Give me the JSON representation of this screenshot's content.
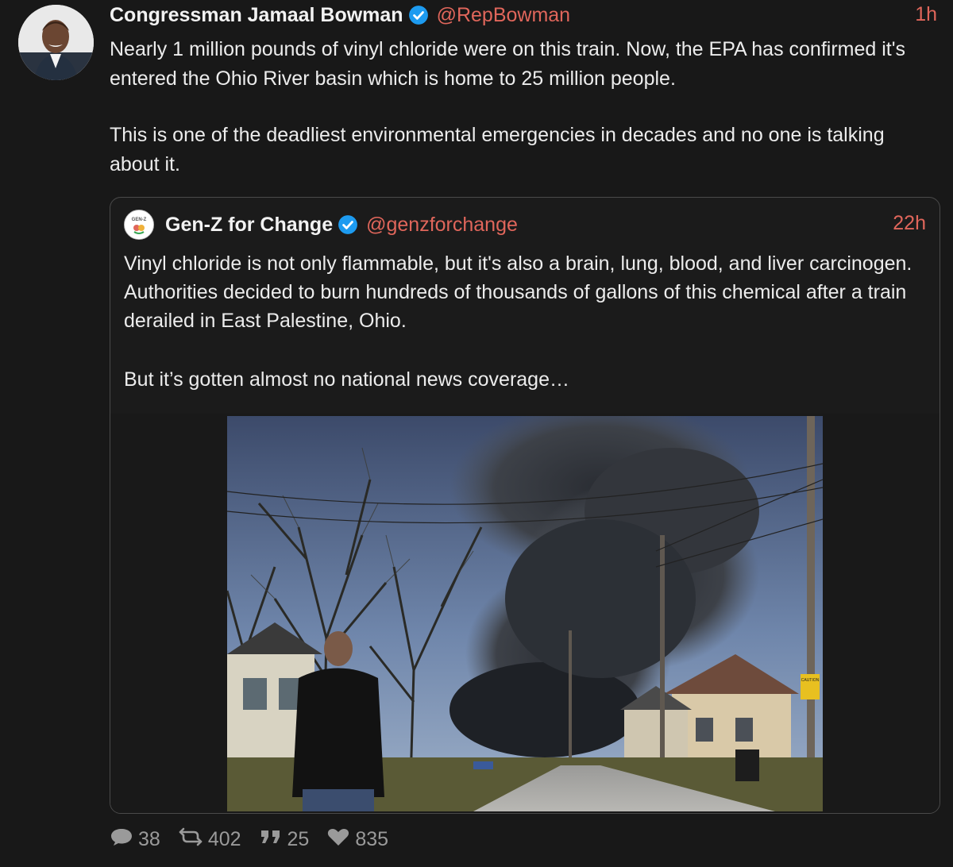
{
  "post": {
    "author_name": "Congressman Jamaal Bowman",
    "handle": "@RepBowman",
    "time": "1h",
    "paragraphs": [
      "Nearly 1 million pounds of vinyl chloride were on this train. Now, the EPA has confirmed it's entered the Ohio River basin which is home to 25 million people.",
      "This is one of the deadliest environmental emergencies in decades and no one is talking about it."
    ]
  },
  "quote": {
    "author_name": "Gen-Z for Change",
    "avatar_text": "GEN-Z",
    "handle": "@genzforchange",
    "time": "22h",
    "paragraphs": [
      "Vinyl chloride is not only flammable, but it's also a brain, lung, blood, and liver carcinogen. Authorities decided to burn hundreds of thousands of gallons of this chemical after a train derailed in East Palestine, Ohio.",
      "But it’s gotten almost no national news coverage…"
    ],
    "image_sign": "CAUTION"
  },
  "actions": {
    "replies": "38",
    "retweets": "402",
    "quotes": "25",
    "likes": "835"
  },
  "colors": {
    "accent": "#e0665b",
    "verified": "#1d9bf0",
    "background": "#181818"
  },
  "icons": [
    "verified-badge-icon",
    "reply-icon",
    "retweet-icon",
    "quote-icon",
    "heart-icon"
  ]
}
